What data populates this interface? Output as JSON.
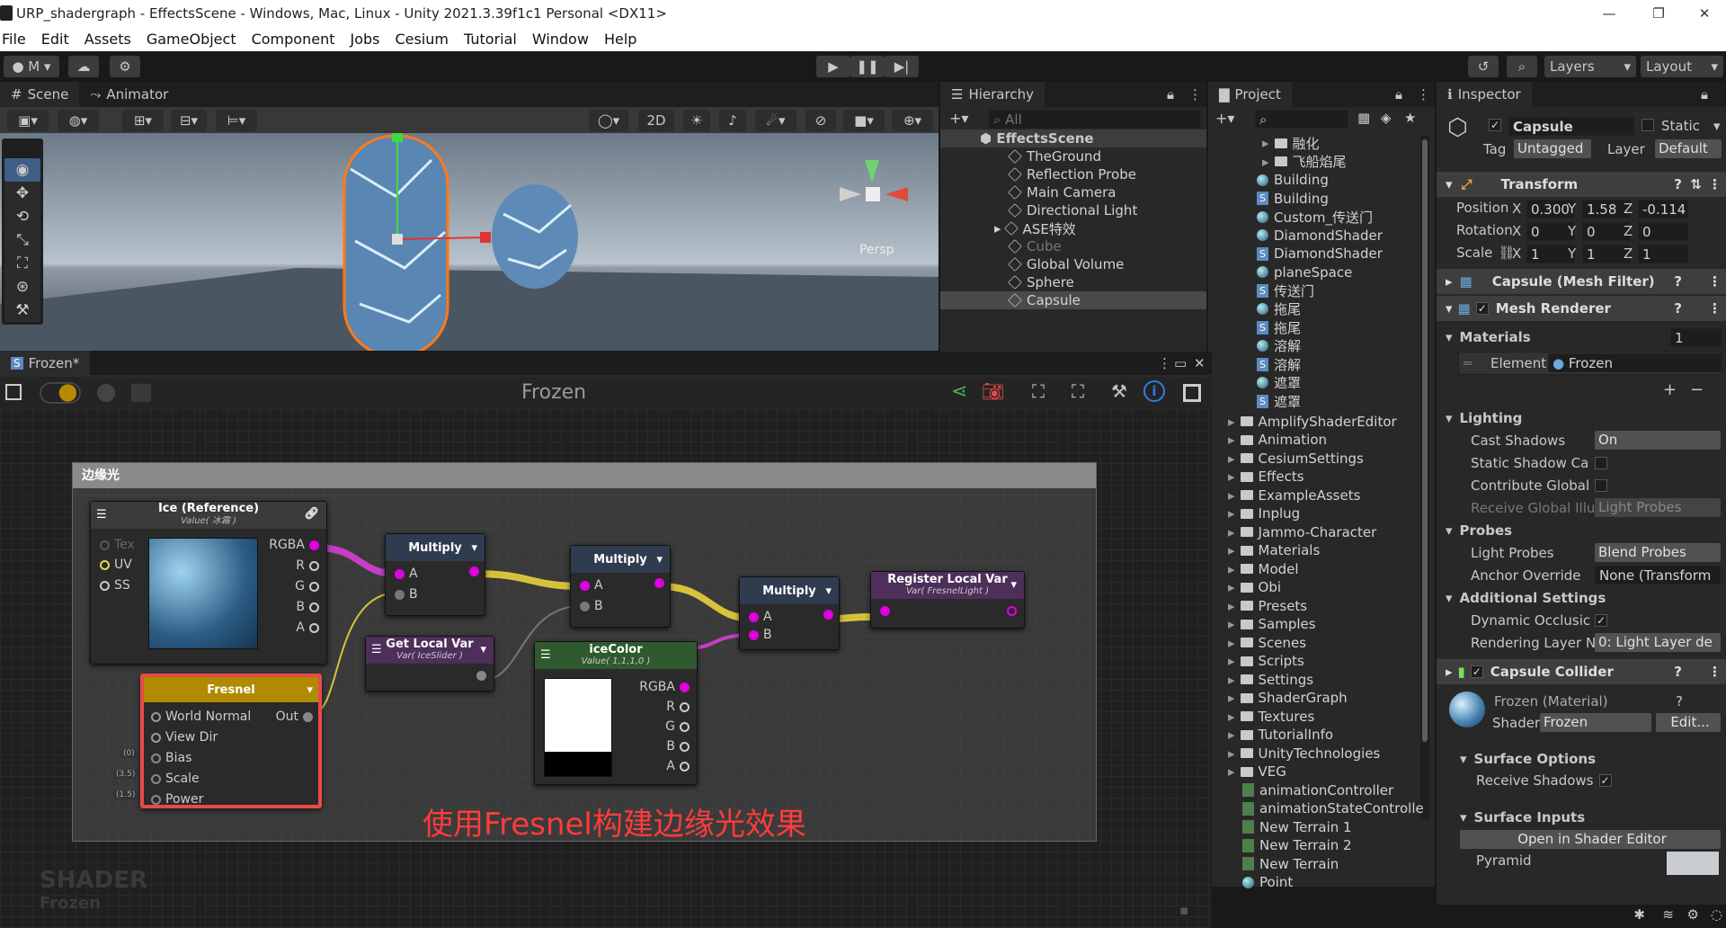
{
  "window": {
    "title": "URP_shadergraph - EffectsScene - Windows, Mac, Linux - Unity 2021.3.39f1c1 Personal <DX11>"
  },
  "menu": [
    "File",
    "Edit",
    "Assets",
    "GameObject",
    "Component",
    "Jobs",
    "Cesium",
    "Tutorial",
    "Window",
    "Help"
  ],
  "toolbar": {
    "account": "M",
    "layers": "Layers",
    "layout": "Layout"
  },
  "scene_tabs": {
    "scene": "Scene",
    "animator": "Animator",
    "mode_2d": "2D",
    "persp": "Persp"
  },
  "hierarchy": {
    "tab": "Hierarchy",
    "search_placeholder": "All",
    "scene": "EffectsScene",
    "items": [
      "TheGround",
      "Reflection Probe",
      "Main Camera",
      "Directional Light",
      "ASE特效",
      "Cube",
      "Global Volume",
      "Sphere",
      "Capsule"
    ]
  },
  "project": {
    "tab": "Project",
    "items": [
      {
        "name": "融化",
        "type": "folder"
      },
      {
        "name": "飞船焰尾",
        "type": "folder"
      },
      {
        "name": "Building",
        "type": "material"
      },
      {
        "name": "Building",
        "type": "shader"
      },
      {
        "name": "Custom_传送门",
        "type": "material"
      },
      {
        "name": "DiamondShader",
        "type": "material"
      },
      {
        "name": "DiamondShader",
        "type": "shader"
      },
      {
        "name": "planeSpace",
        "type": "material"
      },
      {
        "name": "传送门",
        "type": "shader"
      },
      {
        "name": "拖尾",
        "type": "material"
      },
      {
        "name": "拖尾",
        "type": "shader"
      },
      {
        "name": "溶解",
        "type": "material"
      },
      {
        "name": "溶解",
        "type": "shader"
      },
      {
        "name": "遮罩",
        "type": "material"
      },
      {
        "name": "遮罩",
        "type": "shader"
      }
    ],
    "folders": [
      "AmplifyShaderEditor",
      "Animation",
      "CesiumSettings",
      "Effects",
      "ExampleAssets",
      "Inplug",
      "Jammo-Character",
      "Materials",
      "Model",
      "Obi",
      "Presets",
      "Samples",
      "Scenes",
      "Scripts",
      "Settings",
      "ShaderGraph",
      "Textures",
      "TutorialInfo",
      "UnityTechnologies",
      "VEG"
    ],
    "files": [
      "animationController",
      "animationStateControlle",
      "New Terrain 1",
      "New Terrain 2",
      "New Terrain",
      "Point"
    ]
  },
  "inspector": {
    "tab": "Inspector",
    "object": "Capsule",
    "static": "Static",
    "tag_label": "Tag",
    "tag": "Untagged",
    "layer_label": "Layer",
    "layer": "Default",
    "transform": {
      "title": "Transform",
      "position": {
        "label": "Position",
        "x": "0.300",
        "y": "1.58",
        "z": "-0.114"
      },
      "rotation": {
        "label": "Rotation",
        "x": "0",
        "y": "0",
        "z": "0"
      },
      "scale": {
        "label": "Scale",
        "x": "1",
        "y": "1",
        "z": "1"
      }
    },
    "mesh_filter": "Capsule (Mesh Filter)",
    "mesh_renderer": "Mesh Renderer",
    "materials": {
      "label": "Materials",
      "count": "1",
      "element": "Element",
      "value": "Frozen"
    },
    "lighting": {
      "label": "Lighting",
      "cast_shadows": "Cast Shadows",
      "cast_value": "On",
      "static_shadow": "Static Shadow Ca",
      "contribute": "Contribute Global",
      "receive": "Receive Global Illu",
      "receive_value": "Light Probes"
    },
    "probes": {
      "label": "Probes",
      "light_probes": "Light Probes",
      "light_probes_value": "Blend Probes",
      "anchor": "Anchor Override",
      "anchor_value": "None (Transform"
    },
    "additional": {
      "label": "Additional Settings",
      "dynamic": "Dynamic Occlusic",
      "rendering": "Rendering Layer N",
      "rendering_value": "0: Light Layer de"
    },
    "collider": "Capsule Collider",
    "material": {
      "name": "Frozen (Material)",
      "shader_label": "Shader",
      "shader": "Frozen",
      "edit": "Edit..."
    },
    "surface_options": {
      "label": "Surface Options",
      "receive": "Receive Shadows"
    },
    "surface_inputs": {
      "label": "Surface Inputs",
      "open": "Open in Shader Editor",
      "pyramid": "Pyramid"
    }
  },
  "graph": {
    "tab": "Frozen*",
    "title": "Frozen",
    "group": "边缘光",
    "watermark": "SHADER",
    "watermark_sub": "Frozen",
    "annotation": "使用Fresnel构建边缘光效果",
    "nodes": {
      "ice": {
        "title": "Ice (Reference)",
        "sub": "Value( 冰霜 )",
        "inputs": [
          "Tex",
          "UV",
          "SS"
        ],
        "outputs": [
          "RGBA",
          "R",
          "G",
          "B",
          "A"
        ]
      },
      "multiply1": {
        "title": "Multiply",
        "a": "A",
        "b": "B"
      },
      "multiply2": {
        "title": "Multiply",
        "a": "A",
        "b": "B"
      },
      "multiply3": {
        "title": "Multiply",
        "a": "A",
        "b": "B"
      },
      "register": {
        "title": "Register Local Var",
        "sub": "Var( FresnelLight )"
      },
      "getlocal": {
        "title": "Get Local Var",
        "sub": "Var( IceSlider )"
      },
      "icecolor": {
        "title": "iceColor",
        "sub": "Value( 1,1,1,0 )",
        "outputs": [
          "RGBA",
          "R",
          "G",
          "B",
          "A"
        ]
      },
      "fresnel": {
        "title": "Fresnel",
        "inputs": [
          "World Normal",
          "View Dir",
          "Bias",
          "Scale",
          "Power"
        ],
        "out": "Out",
        "defaults": [
          "(0)",
          "(3.5)",
          "(1.5)"
        ]
      }
    }
  },
  "colors": {
    "accent": "#e84a4a",
    "annotation": "#ff3b3b",
    "pin": "#e000e0",
    "wire": "#d8c23c"
  }
}
